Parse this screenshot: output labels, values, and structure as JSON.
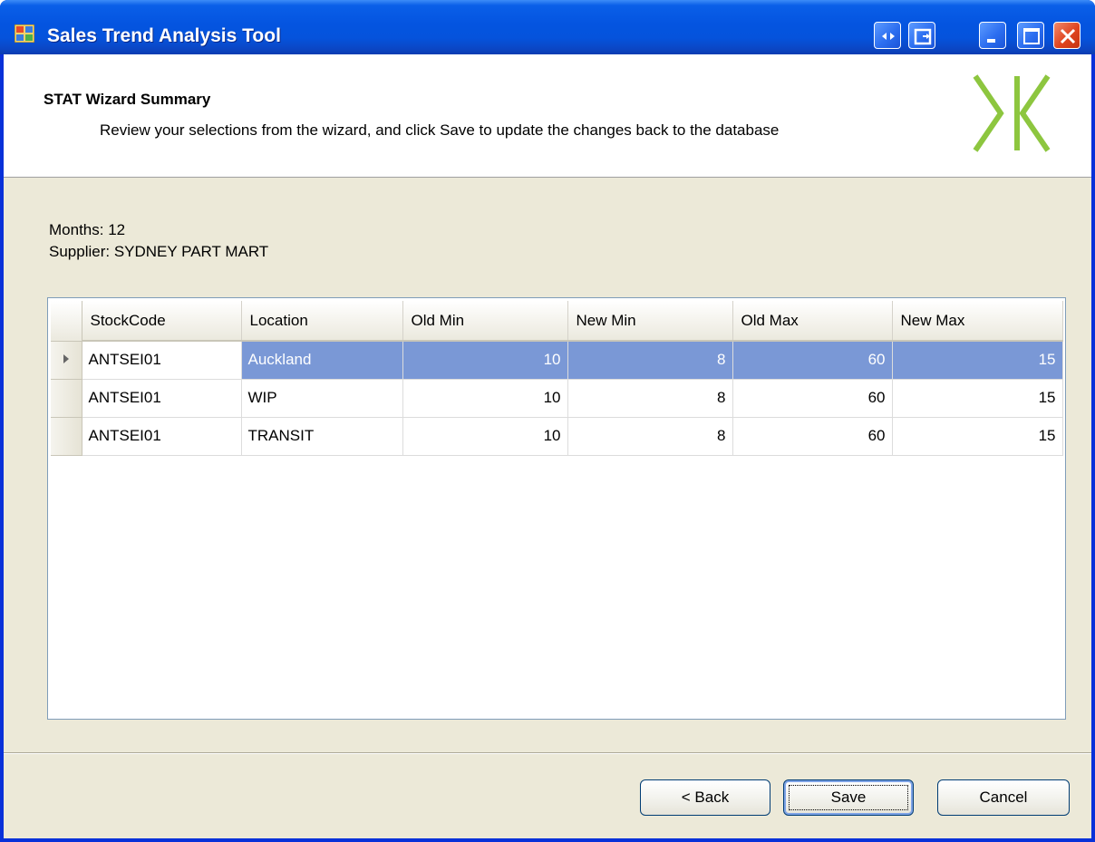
{
  "window": {
    "title": "Sales Trend Analysis Tool"
  },
  "header": {
    "title": "STAT Wizard Summary",
    "description": "Review your selections from the wizard, and click Save to update the changes back to the database"
  },
  "info": {
    "months": "Months: 12",
    "supplier": "Supplier: SYDNEY PART MART"
  },
  "grid": {
    "columns": [
      "StockCode",
      "Location",
      "Old Min",
      "New Min",
      "Old Max",
      "New Max"
    ],
    "rows": [
      [
        "ANTSEI01",
        "Auckland",
        "10",
        "8",
        "60",
        "15"
      ],
      [
        "ANTSEI01",
        "WIP",
        "10",
        "8",
        "60",
        "15"
      ],
      [
        "ANTSEI01",
        "TRANSIT",
        "10",
        "8",
        "60",
        "15"
      ]
    ],
    "selected_row": 0
  },
  "buttons": {
    "back": "< Back",
    "save": "Save",
    "cancel": "Cancel"
  },
  "colors": {
    "titlebar": "#0454e0",
    "selection": "#7a98d6",
    "logo": "#8dc63f"
  }
}
